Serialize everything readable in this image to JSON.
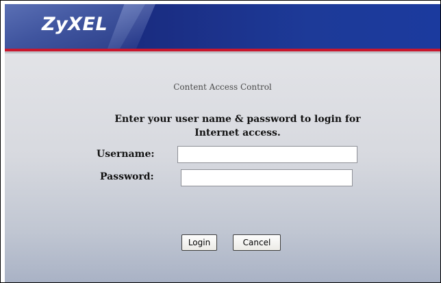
{
  "brand": {
    "logo_text": "ZyXEL",
    "header_color": "#1b2f86",
    "accent_color": "#c8172d"
  },
  "page": {
    "subtitle": "Content Access Control",
    "instructions": "Enter your user name & password to login for Internet access."
  },
  "form": {
    "username_label": "Username:",
    "username_value": "",
    "password_label": "Password:",
    "password_value": "",
    "login_label": "Login",
    "cancel_label": "Cancel"
  }
}
